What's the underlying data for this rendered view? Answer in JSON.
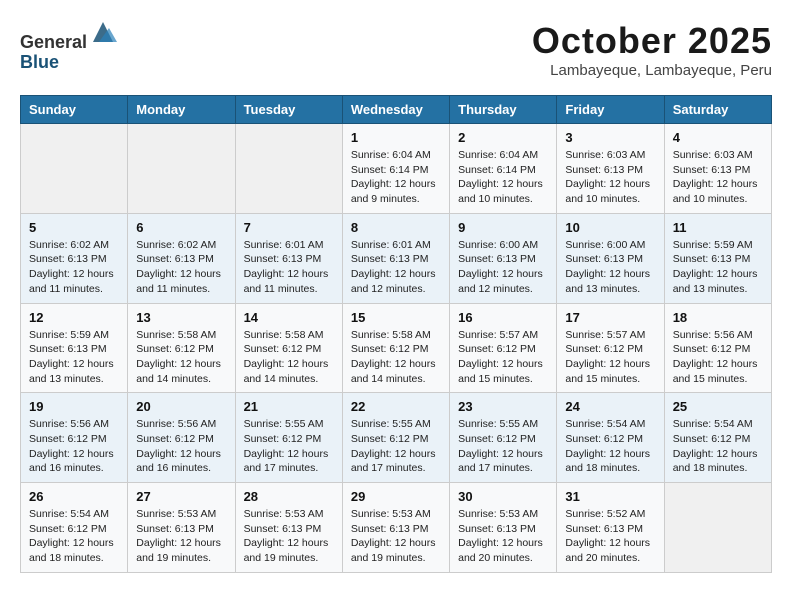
{
  "header": {
    "logo_line1": "General",
    "logo_line2": "Blue",
    "month": "October 2025",
    "location": "Lambayeque, Lambayeque, Peru"
  },
  "weekdays": [
    "Sunday",
    "Monday",
    "Tuesday",
    "Wednesday",
    "Thursday",
    "Friday",
    "Saturday"
  ],
  "weeks": [
    [
      {
        "day": "",
        "info": ""
      },
      {
        "day": "",
        "info": ""
      },
      {
        "day": "",
        "info": ""
      },
      {
        "day": "1",
        "info": "Sunrise: 6:04 AM\nSunset: 6:14 PM\nDaylight: 12 hours\nand 9 minutes."
      },
      {
        "day": "2",
        "info": "Sunrise: 6:04 AM\nSunset: 6:14 PM\nDaylight: 12 hours\nand 10 minutes."
      },
      {
        "day": "3",
        "info": "Sunrise: 6:03 AM\nSunset: 6:13 PM\nDaylight: 12 hours\nand 10 minutes."
      },
      {
        "day": "4",
        "info": "Sunrise: 6:03 AM\nSunset: 6:13 PM\nDaylight: 12 hours\nand 10 minutes."
      }
    ],
    [
      {
        "day": "5",
        "info": "Sunrise: 6:02 AM\nSunset: 6:13 PM\nDaylight: 12 hours\nand 11 minutes."
      },
      {
        "day": "6",
        "info": "Sunrise: 6:02 AM\nSunset: 6:13 PM\nDaylight: 12 hours\nand 11 minutes."
      },
      {
        "day": "7",
        "info": "Sunrise: 6:01 AM\nSunset: 6:13 PM\nDaylight: 12 hours\nand 11 minutes."
      },
      {
        "day": "8",
        "info": "Sunrise: 6:01 AM\nSunset: 6:13 PM\nDaylight: 12 hours\nand 12 minutes."
      },
      {
        "day": "9",
        "info": "Sunrise: 6:00 AM\nSunset: 6:13 PM\nDaylight: 12 hours\nand 12 minutes."
      },
      {
        "day": "10",
        "info": "Sunrise: 6:00 AM\nSunset: 6:13 PM\nDaylight: 12 hours\nand 13 minutes."
      },
      {
        "day": "11",
        "info": "Sunrise: 5:59 AM\nSunset: 6:13 PM\nDaylight: 12 hours\nand 13 minutes."
      }
    ],
    [
      {
        "day": "12",
        "info": "Sunrise: 5:59 AM\nSunset: 6:13 PM\nDaylight: 12 hours\nand 13 minutes."
      },
      {
        "day": "13",
        "info": "Sunrise: 5:58 AM\nSunset: 6:12 PM\nDaylight: 12 hours\nand 14 minutes."
      },
      {
        "day": "14",
        "info": "Sunrise: 5:58 AM\nSunset: 6:12 PM\nDaylight: 12 hours\nand 14 minutes."
      },
      {
        "day": "15",
        "info": "Sunrise: 5:58 AM\nSunset: 6:12 PM\nDaylight: 12 hours\nand 14 minutes."
      },
      {
        "day": "16",
        "info": "Sunrise: 5:57 AM\nSunset: 6:12 PM\nDaylight: 12 hours\nand 15 minutes."
      },
      {
        "day": "17",
        "info": "Sunrise: 5:57 AM\nSunset: 6:12 PM\nDaylight: 12 hours\nand 15 minutes."
      },
      {
        "day": "18",
        "info": "Sunrise: 5:56 AM\nSunset: 6:12 PM\nDaylight: 12 hours\nand 15 minutes."
      }
    ],
    [
      {
        "day": "19",
        "info": "Sunrise: 5:56 AM\nSunset: 6:12 PM\nDaylight: 12 hours\nand 16 minutes."
      },
      {
        "day": "20",
        "info": "Sunrise: 5:56 AM\nSunset: 6:12 PM\nDaylight: 12 hours\nand 16 minutes."
      },
      {
        "day": "21",
        "info": "Sunrise: 5:55 AM\nSunset: 6:12 PM\nDaylight: 12 hours\nand 17 minutes."
      },
      {
        "day": "22",
        "info": "Sunrise: 5:55 AM\nSunset: 6:12 PM\nDaylight: 12 hours\nand 17 minutes."
      },
      {
        "day": "23",
        "info": "Sunrise: 5:55 AM\nSunset: 6:12 PM\nDaylight: 12 hours\nand 17 minutes."
      },
      {
        "day": "24",
        "info": "Sunrise: 5:54 AM\nSunset: 6:12 PM\nDaylight: 12 hours\nand 18 minutes."
      },
      {
        "day": "25",
        "info": "Sunrise: 5:54 AM\nSunset: 6:12 PM\nDaylight: 12 hours\nand 18 minutes."
      }
    ],
    [
      {
        "day": "26",
        "info": "Sunrise: 5:54 AM\nSunset: 6:12 PM\nDaylight: 12 hours\nand 18 minutes."
      },
      {
        "day": "27",
        "info": "Sunrise: 5:53 AM\nSunset: 6:13 PM\nDaylight: 12 hours\nand 19 minutes."
      },
      {
        "day": "28",
        "info": "Sunrise: 5:53 AM\nSunset: 6:13 PM\nDaylight: 12 hours\nand 19 minutes."
      },
      {
        "day": "29",
        "info": "Sunrise: 5:53 AM\nSunset: 6:13 PM\nDaylight: 12 hours\nand 19 minutes."
      },
      {
        "day": "30",
        "info": "Sunrise: 5:53 AM\nSunset: 6:13 PM\nDaylight: 12 hours\nand 20 minutes."
      },
      {
        "day": "31",
        "info": "Sunrise: 5:52 AM\nSunset: 6:13 PM\nDaylight: 12 hours\nand 20 minutes."
      },
      {
        "day": "",
        "info": ""
      }
    ]
  ]
}
